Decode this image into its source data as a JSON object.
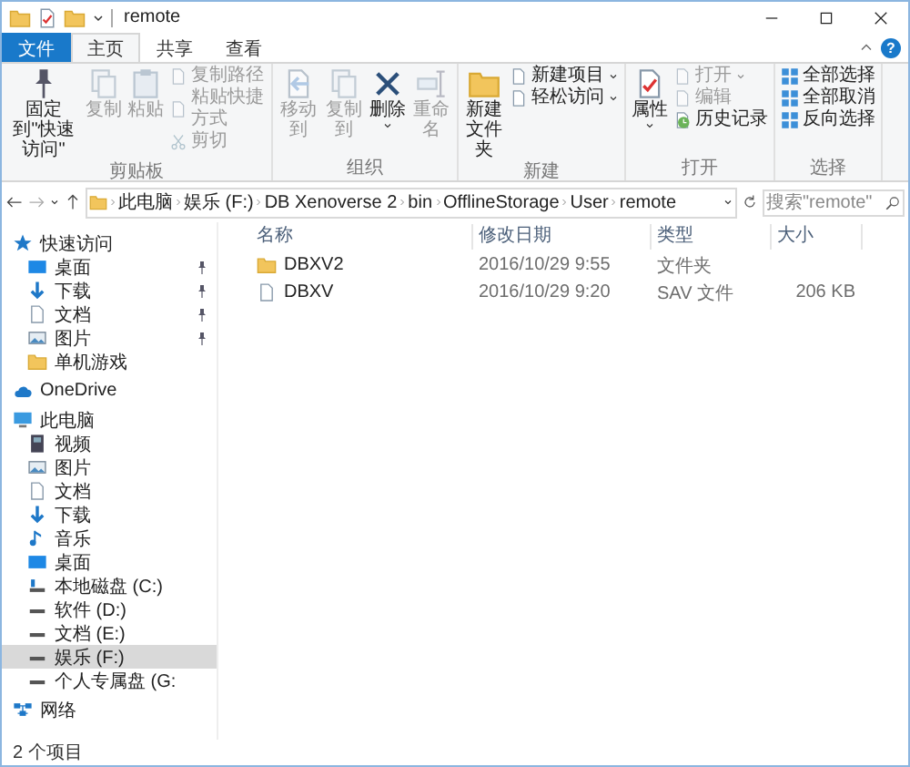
{
  "window": {
    "title": "remote",
    "help": "?"
  },
  "ribbon_tabs": [
    {
      "label": "文件",
      "kind": "file",
      "selected": false
    },
    {
      "label": "主页",
      "kind": "tab",
      "selected": true
    },
    {
      "label": "共享",
      "kind": "tab",
      "selected": false
    },
    {
      "label": "查看",
      "kind": "tab",
      "selected": false
    }
  ],
  "ribbon_groups": [
    {
      "label": "剪贴板",
      "items": [
        {
          "label": "固定到\"快速访问\"",
          "kind": "large",
          "disabled": false,
          "dropdown": false
        },
        {
          "label": "复制",
          "kind": "large",
          "disabled": true,
          "dropdown": false
        },
        {
          "label": "粘贴",
          "kind": "large",
          "disabled": true,
          "dropdown": false
        },
        {
          "label": "复制路径",
          "kind": "small",
          "disabled": true,
          "dropdown": false
        },
        {
          "label": "粘贴快捷方式",
          "kind": "small",
          "disabled": true,
          "dropdown": false
        },
        {
          "label": "剪切",
          "kind": "small",
          "disabled": true,
          "dropdown": false
        }
      ]
    },
    {
      "label": "组织",
      "items": [
        {
          "label": "移动到",
          "kind": "large",
          "disabled": true,
          "dropdown": false
        },
        {
          "label": "复制到",
          "kind": "large",
          "disabled": true,
          "dropdown": false
        },
        {
          "label": "删除",
          "kind": "large",
          "disabled": false,
          "dropdown": true
        },
        {
          "label": "重命名",
          "kind": "large",
          "disabled": true,
          "dropdown": false
        }
      ]
    },
    {
      "label": "新建",
      "items": [
        {
          "label": "新建文件夹",
          "kind": "large",
          "disabled": false,
          "dropdown": false
        },
        {
          "label": "新建项目",
          "kind": "small",
          "disabled": false,
          "dropdown": true
        },
        {
          "label": "轻松访问",
          "kind": "small",
          "disabled": false,
          "dropdown": true
        }
      ]
    },
    {
      "label": "打开",
      "items": [
        {
          "label": "属性",
          "kind": "large",
          "disabled": false,
          "dropdown": true
        },
        {
          "label": "打开",
          "kind": "small",
          "disabled": true,
          "dropdown": true
        },
        {
          "label": "编辑",
          "kind": "small",
          "disabled": true,
          "dropdown": false
        },
        {
          "label": "历史记录",
          "kind": "small",
          "disabled": false,
          "dropdown": false
        }
      ]
    },
    {
      "label": "选择",
      "items": [
        {
          "label": "全部选择",
          "kind": "small",
          "disabled": false,
          "dropdown": false
        },
        {
          "label": "全部取消",
          "kind": "small",
          "disabled": false,
          "dropdown": false
        },
        {
          "label": "反向选择",
          "kind": "small",
          "disabled": false,
          "dropdown": false
        }
      ]
    }
  ],
  "address_bar": {
    "path": [
      "此电脑",
      "娱乐 (F:)",
      "DB Xenoverse 2",
      "bin",
      "OfflineStorage",
      "User",
      "remote"
    ]
  },
  "search": {
    "placeholder": "搜索\"remote\""
  },
  "navigation_pane": [
    {
      "label": "快速访问",
      "selected": false,
      "children": [
        {
          "label": "桌面",
          "pinned": true,
          "selected": false
        },
        {
          "label": "下载",
          "pinned": true,
          "selected": false
        },
        {
          "label": "文档",
          "pinned": true,
          "selected": false
        },
        {
          "label": "图片",
          "pinned": true,
          "selected": false
        },
        {
          "label": "单机游戏",
          "pinned": false,
          "selected": false
        }
      ]
    },
    {
      "label": "OneDrive",
      "selected": false
    },
    {
      "label": "此电脑",
      "selected": false,
      "children": [
        {
          "label": "视频",
          "selected": false
        },
        {
          "label": "图片",
          "selected": false
        },
        {
          "label": "文档",
          "selected": false
        },
        {
          "label": "下载",
          "selected": false
        },
        {
          "label": "音乐",
          "selected": false
        },
        {
          "label": "桌面",
          "selected": false
        },
        {
          "label": "本地磁盘 (C:)",
          "selected": false
        },
        {
          "label": "软件 (D:)",
          "selected": false
        },
        {
          "label": "文档 (E:)",
          "selected": false
        },
        {
          "label": "娱乐 (F:)",
          "selected": true
        },
        {
          "label": "个人专属盘 (G:",
          "selected": false
        }
      ]
    },
    {
      "label": "网络",
      "selected": false
    }
  ],
  "file_list": {
    "columns": [
      "名称",
      "修改日期",
      "类型",
      "大小"
    ],
    "rows": [
      {
        "kind": "folder",
        "name": "DBXV2",
        "modified": "2016/10/29 9:55",
        "type": "文件夹"
      },
      {
        "kind": "file",
        "name": "DBXV",
        "modified": "2016/10/29 9:20",
        "type": "SAV 文件",
        "size": "206 KB"
      }
    ]
  },
  "status_bar": {
    "item_count": "2 个项目"
  }
}
